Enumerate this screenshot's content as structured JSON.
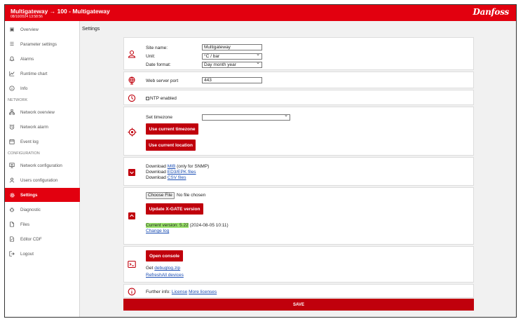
{
  "header": {
    "title": "Multigateway → 100 - Multigateway",
    "date": "08/10/2024 13:58:56",
    "logo": "Danfoss"
  },
  "sidebar": {
    "items": [
      {
        "label": "Overview",
        "icon": "overview-icon"
      },
      {
        "label": "Parameter settings",
        "icon": "list-icon"
      },
      {
        "label": "Alarms",
        "icon": "bell-icon"
      },
      {
        "label": "Runtime chart",
        "icon": "chart-icon"
      },
      {
        "label": "Info",
        "icon": "info-icon"
      }
    ],
    "network_label": "NETWORK",
    "network_items": [
      {
        "label": "Network overview",
        "icon": "network-icon"
      },
      {
        "label": "Network alarm",
        "icon": "alarm-clock-icon"
      },
      {
        "label": "Event log",
        "icon": "calendar-icon"
      }
    ],
    "config_label": "CONFIGURATION",
    "config_items": [
      {
        "label": "Network configuration",
        "icon": "network-config-icon"
      },
      {
        "label": "Users configuration",
        "icon": "user-icon"
      },
      {
        "label": "Settings",
        "icon": "gear-icon"
      },
      {
        "label": "Diagnostic",
        "icon": "bug-icon"
      },
      {
        "label": "Files",
        "icon": "file-icon"
      },
      {
        "label": "Editor CDF",
        "icon": "edit-icon"
      },
      {
        "label": "Logout",
        "icon": "logout-icon"
      }
    ]
  },
  "page_title": "Settings",
  "site": {
    "name_label": "Site name:",
    "name_value": "Multigateway",
    "unit_label": "Unit:",
    "unit_value": "°C / bar",
    "date_format_label": "Date format:",
    "date_format_value": "Day month year"
  },
  "web": {
    "port_label": "Web server port",
    "port_value": "443"
  },
  "ntp": {
    "label": "NTP enabled"
  },
  "timezone": {
    "label": "Set timezone",
    "value": "",
    "use_timezone_btn": "Use current timezone",
    "use_location_btn": "Use current location"
  },
  "downloads": {
    "prefix": "Download",
    "mib_link": "MIB",
    "mib_suffix": "(only for SNMP)",
    "ed3_link": "ED3/EPK files",
    "csv_link": "CSV files"
  },
  "update": {
    "choose_file": "Choose File",
    "no_file": "No file chosen",
    "update_btn": "Update X-GATE version",
    "current_version": "Current version: 5.22",
    "version_date": "(2024-08-05 10:11)",
    "changelog": "Change log"
  },
  "console": {
    "open_btn": "Open console",
    "get_label": "Get",
    "debuglog_link": "debuglog.zip",
    "refresh_link": "RefreshAll devices"
  },
  "info": {
    "prefix": "Further info:",
    "license_link": "License",
    "more_link": "More licenses"
  },
  "save_label": "SAVE"
}
